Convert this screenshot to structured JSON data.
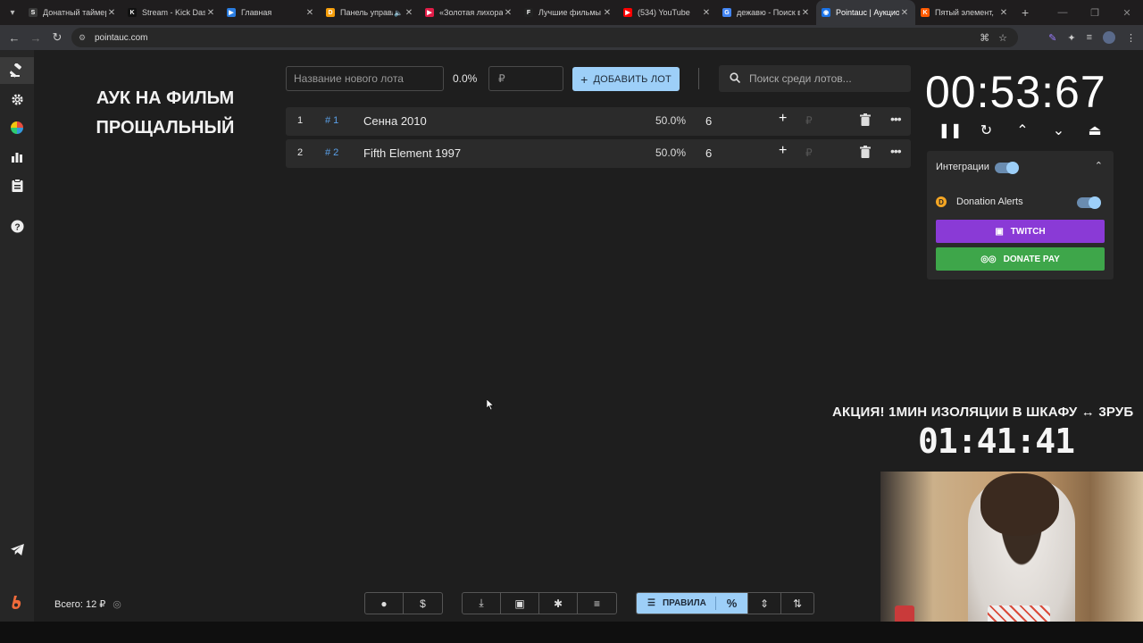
{
  "browser": {
    "tabs": [
      {
        "label": "Донатный таймер",
        "color": "#ffffff",
        "fav_text": "S",
        "fav_bg": "#3a3a3a"
      },
      {
        "label": "Stream - Kick Dashboard",
        "color": "#53fc18",
        "fav_text": "K",
        "fav_bg": "#111111"
      },
      {
        "label": "Главная",
        "color": "#2a7de1",
        "fav_text": "▶",
        "fav_bg": "#2a7de1"
      },
      {
        "label": "Панель управления",
        "color": "#f59e0b",
        "fav_text": "D",
        "fav_bg": "#f59e0b",
        "audio": true
      },
      {
        "label": "«Золотая лихорадка»",
        "color": "#e11d48",
        "fav_text": "▶",
        "fav_bg": "#e11d48"
      },
      {
        "label": "Лучшие фильмы",
        "color": "#ffffff",
        "fav_text": "F",
        "fav_bg": "#222222"
      },
      {
        "label": "(534) YouTube",
        "color": "#ff0000",
        "fav_text": "▶",
        "fav_bg": "#ff0000"
      },
      {
        "label": "дежавю - Поиск в Google",
        "color": "#4285f4",
        "fav_text": "G",
        "fav_bg": "#4285f4"
      },
      {
        "label": "Pointauc | Аукцион",
        "color": "#00a0ff",
        "fav_text": "◉",
        "fav_bg": "#1a73e8",
        "active": true
      },
      {
        "label": "Пятый элемент,",
        "color": "#ff5a00",
        "fav_text": "K",
        "fav_bg": "#ff5a00"
      }
    ],
    "url": "pointauc.com"
  },
  "auction": {
    "title": "АУК НА ФИЛЬМ ПРОЩАЛЬНЫЙ",
    "new_lot_placeholder": "Название нового лота",
    "pct_label": "0.0%",
    "amount_placeholder": "₽",
    "add_lot_label": "ДОБАВИТЬ ЛОТ",
    "search_placeholder": "Поиск среди лотов...",
    "lots": [
      {
        "index": "1",
        "id": "# 1",
        "name": "Сенна 2010",
        "pct": "50.0%",
        "amount": "6",
        "currency": "₽"
      },
      {
        "index": "2",
        "id": "# 2",
        "name": "Fifth Element 1997",
        "pct": "50.0%",
        "amount": "6",
        "currency": "₽"
      }
    ],
    "timer": "00:53:67",
    "total_label": "Всего: 12 ₽"
  },
  "integrations": {
    "header": "Интеграции",
    "donation_alerts": "Donation Alerts",
    "twitch_label": "TWITCH",
    "donatepay_label": "DONATE PAY"
  },
  "bottom": {
    "rules_label": "ПРАВИЛА",
    "pct_symbol": "%"
  },
  "overlay": {
    "promo_text": "АКЦИЯ! 1МИН ИЗОЛЯЦИИ В ШКАФУ ↔ 3РУБ",
    "promo_timer": "01:41:41"
  },
  "colors": {
    "accent": "#9dcff8",
    "twitch": "#8a3ad6",
    "donatepay": "#3ea64a",
    "lot_id": "#5aa0e8",
    "background": "#1e1e1e"
  }
}
